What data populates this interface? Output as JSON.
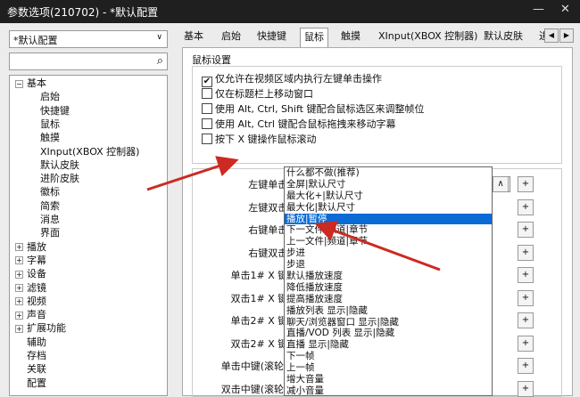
{
  "window": {
    "title": "参数选项(210702) - *默认配置",
    "minimize": "—",
    "close": "✕"
  },
  "left": {
    "preset": "*默认配置",
    "tree": [
      {
        "label": "基本",
        "expanded": true,
        "level": 0
      },
      {
        "label": "启始",
        "level": 1
      },
      {
        "label": "快捷键",
        "level": 1
      },
      {
        "label": "鼠标",
        "level": 1
      },
      {
        "label": "触摸",
        "level": 1
      },
      {
        "label": "XInput(XBOX 控制器)",
        "level": 1
      },
      {
        "label": "默认皮肤",
        "level": 1
      },
      {
        "label": "进阶皮肤",
        "level": 1
      },
      {
        "label": "徽标",
        "level": 1
      },
      {
        "label": "简索",
        "level": 1
      },
      {
        "label": "消息",
        "level": 1
      },
      {
        "label": "界面",
        "level": 1
      },
      {
        "label": "播放",
        "collapsed": true,
        "level": 0
      },
      {
        "label": "字幕",
        "collapsed": true,
        "level": 0
      },
      {
        "label": "设备",
        "collapsed": true,
        "level": 0
      },
      {
        "label": "滤镜",
        "collapsed": true,
        "level": 0
      },
      {
        "label": "视频",
        "collapsed": true,
        "level": 0
      },
      {
        "label": "声音",
        "collapsed": true,
        "level": 0
      },
      {
        "label": "扩展功能",
        "collapsed": true,
        "level": 0
      },
      {
        "label": "辅助",
        "level": 0
      },
      {
        "label": "存档",
        "level": 0
      },
      {
        "label": "关联",
        "level": 0
      },
      {
        "label": "配置",
        "level": 0
      }
    ]
  },
  "tabs": [
    "基本",
    "启始",
    "快捷键",
    "鼠标",
    "触摸",
    "XInput(XBOX 控制器)",
    "默认皮肤",
    "进"
  ],
  "active_tab": "鼠标",
  "panel": {
    "section_title": "鼠标设置",
    "checkboxes": [
      {
        "label": "仅允许在视频区域内执行左键单击操作",
        "checked": true
      },
      {
        "label": "仅在标题栏上移动窗口",
        "checked": false
      },
      {
        "label": "使用 Alt, Ctrl, Shift 键配合鼠标选区来调整帧位",
        "checked": false
      },
      {
        "label": "使用 Alt, Ctrl 键配合鼠标拖拽来移动字幕",
        "checked": false
      },
      {
        "label": "按下 X 键操作鼠标滚动",
        "checked": false
      }
    ],
    "actions": [
      {
        "label": "左键单击:",
        "value": "什么都不做(推荐)"
      },
      {
        "label": "左键双击:"
      },
      {
        "label": "右键单击:"
      },
      {
        "label": "右键双击:"
      },
      {
        "label": "单击1# X 键:"
      },
      {
        "label": "双击1# X 键:"
      },
      {
        "label": "单击2# X 键:"
      },
      {
        "label": "双击2# X 键:"
      },
      {
        "label": "单击中键(滚轮):"
      },
      {
        "label": "双击中键(滚轮):"
      }
    ],
    "up_btn": "∧",
    "plus_btn": "+",
    "dropdown_options": [
      "什么都不做(推荐)",
      "全屏|默认尺寸",
      "最大化+|默认尺寸",
      "最大化|默认尺寸",
      "播放|暂停",
      "下一文件|频道|章节",
      "上一文件|频道|章节",
      "步进",
      "步退",
      "默认播放速度",
      "降低播放速度",
      "提高播放速度",
      "播放列表 显示|隐藏",
      "聊天/浏览器窗口 显示|隐藏",
      "直播/VOD 列表 显示|隐藏",
      "直播 显示|隐藏",
      "下一帧",
      "上一帧",
      "增大音量",
      "减小音量"
    ],
    "selected_option": "播放|暂停"
  },
  "colors": {
    "arrow": "#cc2a22",
    "highlight": "#0a6ad6"
  }
}
